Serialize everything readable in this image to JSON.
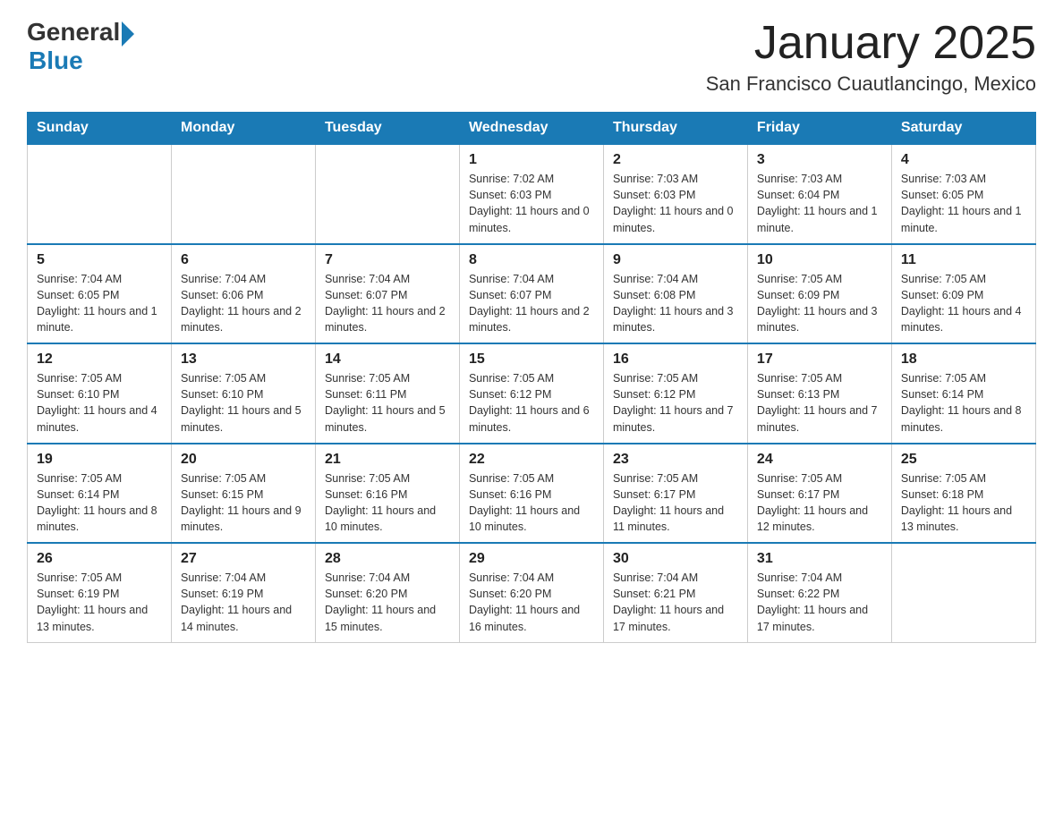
{
  "header": {
    "logo_general": "General",
    "logo_blue": "Blue",
    "title": "January 2025",
    "subtitle": "San Francisco Cuautlancingo, Mexico"
  },
  "days_of_week": [
    "Sunday",
    "Monday",
    "Tuesday",
    "Wednesday",
    "Thursday",
    "Friday",
    "Saturday"
  ],
  "weeks": [
    [
      {
        "day": "",
        "info": ""
      },
      {
        "day": "",
        "info": ""
      },
      {
        "day": "",
        "info": ""
      },
      {
        "day": "1",
        "info": "Sunrise: 7:02 AM\nSunset: 6:03 PM\nDaylight: 11 hours and 0 minutes."
      },
      {
        "day": "2",
        "info": "Sunrise: 7:03 AM\nSunset: 6:03 PM\nDaylight: 11 hours and 0 minutes."
      },
      {
        "day": "3",
        "info": "Sunrise: 7:03 AM\nSunset: 6:04 PM\nDaylight: 11 hours and 1 minute."
      },
      {
        "day": "4",
        "info": "Sunrise: 7:03 AM\nSunset: 6:05 PM\nDaylight: 11 hours and 1 minute."
      }
    ],
    [
      {
        "day": "5",
        "info": "Sunrise: 7:04 AM\nSunset: 6:05 PM\nDaylight: 11 hours and 1 minute."
      },
      {
        "day": "6",
        "info": "Sunrise: 7:04 AM\nSunset: 6:06 PM\nDaylight: 11 hours and 2 minutes."
      },
      {
        "day": "7",
        "info": "Sunrise: 7:04 AM\nSunset: 6:07 PM\nDaylight: 11 hours and 2 minutes."
      },
      {
        "day": "8",
        "info": "Sunrise: 7:04 AM\nSunset: 6:07 PM\nDaylight: 11 hours and 2 minutes."
      },
      {
        "day": "9",
        "info": "Sunrise: 7:04 AM\nSunset: 6:08 PM\nDaylight: 11 hours and 3 minutes."
      },
      {
        "day": "10",
        "info": "Sunrise: 7:05 AM\nSunset: 6:09 PM\nDaylight: 11 hours and 3 minutes."
      },
      {
        "day": "11",
        "info": "Sunrise: 7:05 AM\nSunset: 6:09 PM\nDaylight: 11 hours and 4 minutes."
      }
    ],
    [
      {
        "day": "12",
        "info": "Sunrise: 7:05 AM\nSunset: 6:10 PM\nDaylight: 11 hours and 4 minutes."
      },
      {
        "day": "13",
        "info": "Sunrise: 7:05 AM\nSunset: 6:10 PM\nDaylight: 11 hours and 5 minutes."
      },
      {
        "day": "14",
        "info": "Sunrise: 7:05 AM\nSunset: 6:11 PM\nDaylight: 11 hours and 5 minutes."
      },
      {
        "day": "15",
        "info": "Sunrise: 7:05 AM\nSunset: 6:12 PM\nDaylight: 11 hours and 6 minutes."
      },
      {
        "day": "16",
        "info": "Sunrise: 7:05 AM\nSunset: 6:12 PM\nDaylight: 11 hours and 7 minutes."
      },
      {
        "day": "17",
        "info": "Sunrise: 7:05 AM\nSunset: 6:13 PM\nDaylight: 11 hours and 7 minutes."
      },
      {
        "day": "18",
        "info": "Sunrise: 7:05 AM\nSunset: 6:14 PM\nDaylight: 11 hours and 8 minutes."
      }
    ],
    [
      {
        "day": "19",
        "info": "Sunrise: 7:05 AM\nSunset: 6:14 PM\nDaylight: 11 hours and 8 minutes."
      },
      {
        "day": "20",
        "info": "Sunrise: 7:05 AM\nSunset: 6:15 PM\nDaylight: 11 hours and 9 minutes."
      },
      {
        "day": "21",
        "info": "Sunrise: 7:05 AM\nSunset: 6:16 PM\nDaylight: 11 hours and 10 minutes."
      },
      {
        "day": "22",
        "info": "Sunrise: 7:05 AM\nSunset: 6:16 PM\nDaylight: 11 hours and 10 minutes."
      },
      {
        "day": "23",
        "info": "Sunrise: 7:05 AM\nSunset: 6:17 PM\nDaylight: 11 hours and 11 minutes."
      },
      {
        "day": "24",
        "info": "Sunrise: 7:05 AM\nSunset: 6:17 PM\nDaylight: 11 hours and 12 minutes."
      },
      {
        "day": "25",
        "info": "Sunrise: 7:05 AM\nSunset: 6:18 PM\nDaylight: 11 hours and 13 minutes."
      }
    ],
    [
      {
        "day": "26",
        "info": "Sunrise: 7:05 AM\nSunset: 6:19 PM\nDaylight: 11 hours and 13 minutes."
      },
      {
        "day": "27",
        "info": "Sunrise: 7:04 AM\nSunset: 6:19 PM\nDaylight: 11 hours and 14 minutes."
      },
      {
        "day": "28",
        "info": "Sunrise: 7:04 AM\nSunset: 6:20 PM\nDaylight: 11 hours and 15 minutes."
      },
      {
        "day": "29",
        "info": "Sunrise: 7:04 AM\nSunset: 6:20 PM\nDaylight: 11 hours and 16 minutes."
      },
      {
        "day": "30",
        "info": "Sunrise: 7:04 AM\nSunset: 6:21 PM\nDaylight: 11 hours and 17 minutes."
      },
      {
        "day": "31",
        "info": "Sunrise: 7:04 AM\nSunset: 6:22 PM\nDaylight: 11 hours and 17 minutes."
      },
      {
        "day": "",
        "info": ""
      }
    ]
  ]
}
